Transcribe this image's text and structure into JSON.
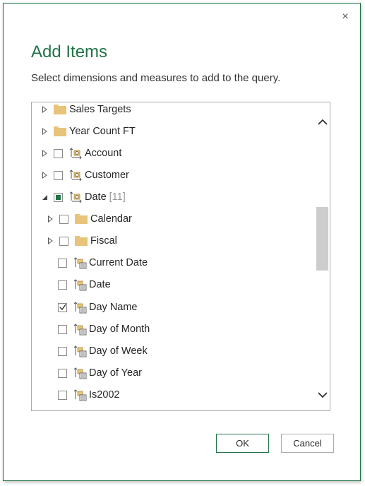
{
  "dialog": {
    "title": "Add Items",
    "subtitle": "Select dimensions and measures to add to the query.",
    "close_glyph": "×",
    "ok_label": "OK",
    "cancel_label": "Cancel"
  },
  "tree": {
    "items": [
      {
        "label": "Sales Targets",
        "type": "folder",
        "expander": "collapsed",
        "checkbox": "none"
      },
      {
        "label": "Year Count FT",
        "type": "folder",
        "expander": "collapsed",
        "checkbox": "none"
      },
      {
        "label": "Account",
        "type": "dimension",
        "expander": "collapsed",
        "checkbox": "unchecked"
      },
      {
        "label": "Customer",
        "type": "dimension",
        "expander": "collapsed",
        "checkbox": "unchecked"
      },
      {
        "label": "Date",
        "count": "[11]",
        "type": "dimension",
        "expander": "expanded",
        "checkbox": "partial"
      },
      {
        "label": "Calendar",
        "type": "folder",
        "expander": "collapsed",
        "checkbox": "unchecked"
      },
      {
        "label": "Fiscal",
        "type": "folder",
        "expander": "collapsed",
        "checkbox": "unchecked"
      },
      {
        "label": "Current Date",
        "type": "attribute",
        "expander": "none",
        "checkbox": "unchecked"
      },
      {
        "label": "Date",
        "type": "attribute",
        "expander": "none",
        "checkbox": "unchecked"
      },
      {
        "label": "Day Name",
        "type": "attribute",
        "expander": "none",
        "checkbox": "checked"
      },
      {
        "label": "Day of Month",
        "type": "attribute",
        "expander": "none",
        "checkbox": "unchecked"
      },
      {
        "label": "Day of Week",
        "type": "attribute",
        "expander": "none",
        "checkbox": "unchecked"
      },
      {
        "label": "Day of Year",
        "type": "attribute",
        "expander": "none",
        "checkbox": "unchecked"
      },
      {
        "label": "Is2002",
        "type": "attribute",
        "expander": "none",
        "checkbox": "unchecked"
      }
    ]
  },
  "colors": {
    "accent": "#217346",
    "folder": "#e8c37a",
    "thumb": "#cdcdcd"
  },
  "icons": {
    "close": "close-icon",
    "expand_collapsed": "triangle-right-icon",
    "expand_expanded": "triangle-down-icon",
    "folder": "folder-icon",
    "dimension": "dimension-cube-icon",
    "attribute": "attribute-hierarchy-icon",
    "scroll_up": "chevron-up-icon",
    "scroll_down": "chevron-down-icon"
  }
}
